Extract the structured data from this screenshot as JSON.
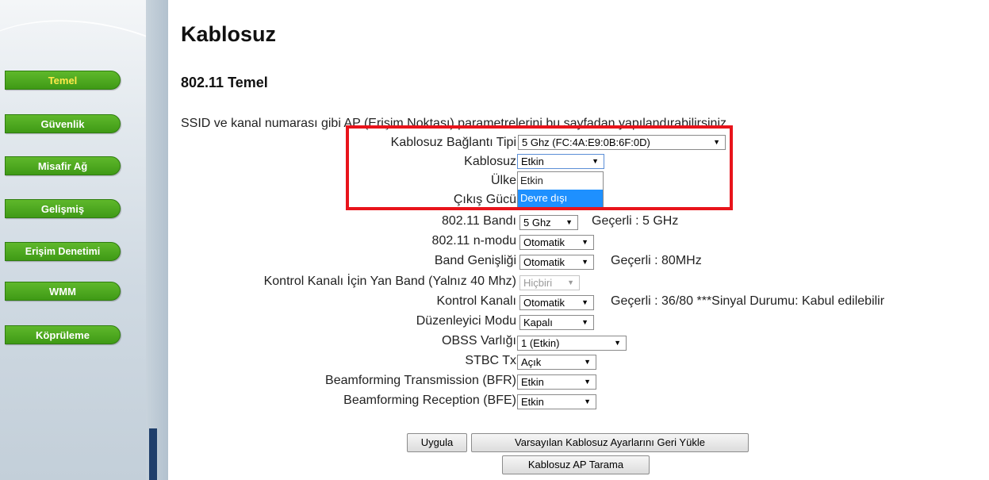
{
  "sidebar": {
    "items": [
      {
        "label": "Temel",
        "active": true
      },
      {
        "label": "Güvenlik"
      },
      {
        "label": "Misafir Ağ"
      },
      {
        "label": "Gelişmiş"
      },
      {
        "label": "Erişim Denetimi"
      },
      {
        "label": "WMM"
      },
      {
        "label": "Köprüleme"
      }
    ]
  },
  "page": {
    "title": "Kablosuz",
    "section_title": "802.11 Temel",
    "description": "SSID ve kanal numarası gibi AP (Erişim Noktası) parametrelerini bu sayfadan yapılandırabilirsiniz."
  },
  "form": {
    "connection_type": {
      "label": "Kablosuz Bağlantı Tipi",
      "value": "5 Ghz (FC:4A:E9:0B:6F:0D)"
    },
    "wireless": {
      "label": "Kablosuz",
      "value": "Etkin",
      "options": [
        "Etkin",
        "Devre dışı"
      ]
    },
    "country": {
      "label": "Ülke"
    },
    "output_power": {
      "label": "Çıkış Gücü"
    },
    "band": {
      "label": "802.11 Bandı",
      "value": "5 Ghz",
      "current": "Geçerli :  5 GHz"
    },
    "n_mode": {
      "label": "802.11 n-modu",
      "value": "Otomatik"
    },
    "bandwidth": {
      "label": "Band Genişliği",
      "value": "Otomatik",
      "current": "Geçerli :  80MHz"
    },
    "sideband": {
      "label": "Kontrol Kanalı İçin Yan Band (Yalnız 40 Mhz)",
      "value": "Hiçbiri"
    },
    "control_channel": {
      "label": "Kontrol Kanalı",
      "value": "Otomatik",
      "current": "Geçerli :  36/80 ***Sinyal Durumu: Kabul edilebilir"
    },
    "regulatory_mode": {
      "label": "Düzenleyici Modu",
      "value": "Kapalı"
    },
    "obss": {
      "label": "OBSS Varlığı",
      "value": "1 (Etkin)"
    },
    "stbc_tx": {
      "label": "STBC Tx",
      "value": "Açık"
    },
    "bfr": {
      "label": "Beamforming Transmission (BFR)",
      "value": "Etkin"
    },
    "bfe": {
      "label": "Beamforming Reception (BFE)",
      "value": "Etkin"
    }
  },
  "buttons": {
    "apply": "Uygula",
    "restore_defaults": "Varsayılan Kablosuz Ayarlarını Geri Yükle",
    "ap_scan": "Kablosuz AP Tarama"
  },
  "colors": {
    "nav_green": "#4aa61d",
    "nav_active_text": "#ffe94a",
    "highlight_red": "#e8141b",
    "option_highlight": "#1e90ff"
  }
}
